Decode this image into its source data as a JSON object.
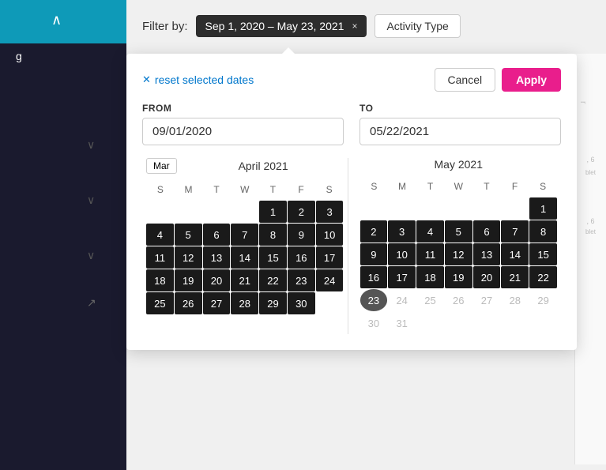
{
  "sidebar": {
    "label": "g",
    "chevron_up": "∧",
    "chevrons": [
      "∨",
      "∨",
      "∨"
    ],
    "link_icon": "↗"
  },
  "filter_bar": {
    "label": "Filter by:",
    "date_chip": "Sep 1, 2020 – May 23, 2021",
    "close_x": "×",
    "activity_type_label": "Activity Type"
  },
  "popup": {
    "reset_label": "reset selected dates",
    "cancel_label": "Cancel",
    "apply_label": "Apply",
    "from_label": "FROM",
    "from_value": "09/01/2020",
    "to_label": "TO",
    "to_value": "05/22/2021",
    "left_calendar": {
      "nav_label": "Mar",
      "month_title": "April 2021",
      "weekdays": [
        "S",
        "M",
        "T",
        "W",
        "T",
        "F",
        "S"
      ],
      "weeks": [
        [
          "",
          "",
          "",
          "",
          "1",
          "2",
          "3"
        ],
        [
          "4",
          "5",
          "6",
          "7",
          "8",
          "9",
          "10"
        ],
        [
          "11",
          "12",
          "13",
          "14",
          "15",
          "16",
          "17"
        ],
        [
          "18",
          "19",
          "20",
          "21",
          "22",
          "23",
          "24"
        ],
        [
          "25",
          "26",
          "27",
          "28",
          "29",
          "30",
          ""
        ]
      ],
      "selected_range": [
        1,
        2,
        3,
        4,
        5,
        6,
        7,
        8,
        9,
        10,
        11,
        12,
        13,
        14,
        15,
        16,
        17,
        18,
        19,
        20,
        21,
        22,
        23,
        24,
        25,
        26,
        27,
        28,
        29,
        30
      ]
    },
    "right_calendar": {
      "month_title": "May 2021",
      "weekdays": [
        "S",
        "M",
        "T",
        "W",
        "T",
        "F",
        "S"
      ],
      "weeks": [
        [
          "",
          "",
          "",
          "",
          "",
          "",
          "1"
        ],
        [
          "2",
          "3",
          "4",
          "5",
          "6",
          "7",
          "8"
        ],
        [
          "9",
          "10",
          "11",
          "12",
          "13",
          "14",
          "15"
        ],
        [
          "16",
          "17",
          "18",
          "19",
          "20",
          "21",
          "22"
        ],
        [
          "23",
          "24",
          "25",
          "26",
          "27",
          "28",
          "29"
        ],
        [
          "30",
          "31",
          "",
          "",
          "",
          "",
          ""
        ]
      ],
      "selected_range": [
        1,
        2,
        3,
        4,
        5,
        6,
        7,
        8,
        9,
        10,
        11,
        12,
        13,
        14,
        15,
        16,
        17,
        18,
        19,
        20,
        21,
        22
      ],
      "today": 23,
      "dimmed": [
        24,
        25,
        26,
        27,
        28,
        29,
        30,
        31
      ]
    }
  }
}
